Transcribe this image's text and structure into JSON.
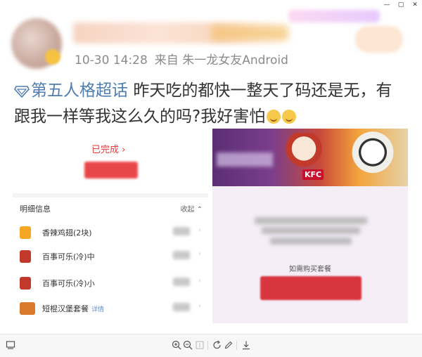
{
  "window": {
    "controls": [
      "—",
      "▢",
      "✕"
    ]
  },
  "post": {
    "timestamp": "10-30 14:28",
    "source": "来自 朱一龙女友Android",
    "topic": "第五人格超话",
    "body": "昨天吃的都快一整天了码还是无，有跟我一样等我这么久的吗?我好害怕"
  },
  "left_image": {
    "status_link": "已完成 ›",
    "detail_header": "明细信息",
    "collapse_label": "收起 ⌃",
    "items": [
      {
        "name": "香辣鸡翅(2块)",
        "sub": "",
        "icon_color": "#f5a623"
      },
      {
        "name": "百事可乐(冷)中",
        "sub": "",
        "icon_color": "#c0392b"
      },
      {
        "name": "百事可乐(冷)小",
        "sub": "",
        "icon_color": "#c0392b"
      },
      {
        "name": "短棍汉堡套餐",
        "sub": "详情",
        "icon_color": "#d9792b"
      }
    ]
  },
  "right_image": {
    "brand": "KFC",
    "buy_text": "如需购买套餐"
  },
  "toolbar": {
    "icons": [
      "screen-icon",
      "zoom-in-icon",
      "zoom-out-icon",
      "actual-size-icon",
      "rotate-icon",
      "edit-icon",
      "download-icon"
    ]
  }
}
